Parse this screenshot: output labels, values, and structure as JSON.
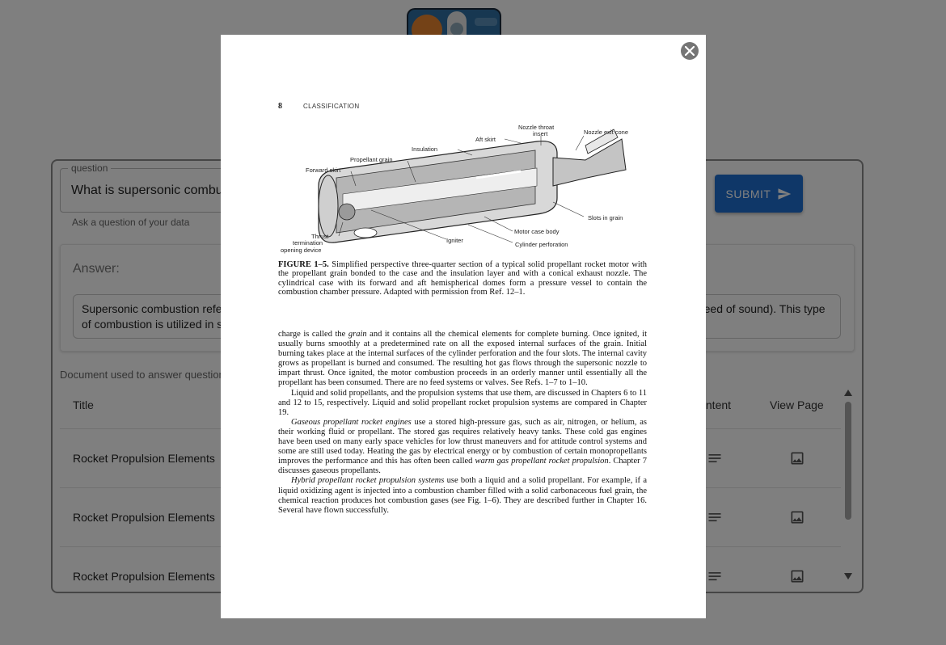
{
  "app": {
    "logo_name": "rocket-logo"
  },
  "form": {
    "question_legend": "question",
    "question_value": "What is supersonic combustion?",
    "helper_text": "Ask a question of your data",
    "submit_label": "SUBMIT"
  },
  "answer": {
    "label": "Answer:",
    "text": "Supersonic combustion refers to combustion that takes place in a flow that is moving at supersonic speed (faster than the speed of sound). This type of combustion is utilized in scramjet engines, which are designed to operate at hypersonic speeds."
  },
  "documents": {
    "caption": "Document used to answer question",
    "columns": [
      "Title",
      "Content",
      "View Page"
    ],
    "rows": [
      {
        "title": "Rocket Propulsion Elements"
      },
      {
        "title": "Rocket Propulsion Elements"
      },
      {
        "title": "Rocket Propulsion Elements"
      }
    ]
  },
  "modal": {
    "page_number": "8",
    "page_header": "CLASSIFICATION",
    "diagram_labels": {
      "nozzle_throat": "Nozzle throat",
      "insert": "insert",
      "nozzle_exit": "Nozzle exit cone",
      "aft_skirt": "Aft skirt",
      "insulation": "Insulation",
      "propellant_grain": "Propellant grain",
      "forward_skirt": "Forward skirt",
      "slots": "Slots in grain",
      "motor_case": "Motor case body",
      "cylinder_perf": "Cylinder perforation",
      "igniter": "Igniter",
      "thrust": "Thrust",
      "termination": "termination",
      "opening_device": "opening device"
    },
    "figure_caption_label": "FIGURE 1–5.",
    "figure_caption_text": "Simplified perspective three-quarter section of a typical solid propellant rocket motor with the propellant grain bonded to the case and the insulation layer and with a conical exhaust nozzle. The cylindrical case with its forward and aft hemispherical domes form a pressure vessel to contain the combustion chamber pressure. Adapted with permission from Ref. 12–1.",
    "para1_a": "charge is called the ",
    "para1_term": "grain",
    "para1_b": " and it contains all the chemical elements for complete burning. Once ignited, it usually burns smoothly at a predetermined rate on all the exposed internal surfaces of the grain. Initial burning takes place at the internal surfaces of the cylinder perforation and the four slots. The internal cavity grows as propellant is burned and consumed. The resulting hot gas flows through the supersonic nozzle to impart thrust. Once ignited, the motor combustion proceeds in an orderly manner until essentially all the propellant has been consumed. There are no feed systems or valves. See Refs. 1–7 to 1–10.",
    "para2": "Liquid and solid propellants, and the propulsion systems that use them, are discussed in Chapters 6 to 11 and 12 to 15, respectively. Liquid and solid propellant rocket propulsion systems are compared in Chapter 19.",
    "para3_term": "Gaseous propellant rocket engines",
    "para3_a": " use a stored high-pressure gas, such as air, nitrogen, or helium, as their working fluid or propellant. The stored gas requires relatively heavy tanks. These cold gas engines have been used on many early space vehicles for low thrust maneuvers and for attitude control systems and some are still used today. Heating the gas by electrical energy or by combustion of certain monopropellants improves the performance and this has often been called ",
    "para3_term2": "warm gas propellant rocket propulsion",
    "para3_b": ". Chapter 7 discusses gaseous propellants.",
    "para4_term": "Hybrid propellant rocket propulsion systems",
    "para4_a": " use both a liquid and a solid propellant. For example, if a liquid oxidizing agent is injected into a combustion chamber filled with a solid carbonaceous fuel grain, the chemical reaction produces hot combustion gases (see Fig. 1–6). They are described further in Chapter 16. Several have flown successfully."
  },
  "colors": {
    "primary": "#1f6fd1",
    "backdrop": "rgba(0,0,0,0.5)"
  },
  "icons": [
    "send-icon",
    "lines-icon",
    "image-icon",
    "close-icon",
    "scroll-up-icon",
    "scroll-down-icon"
  ]
}
